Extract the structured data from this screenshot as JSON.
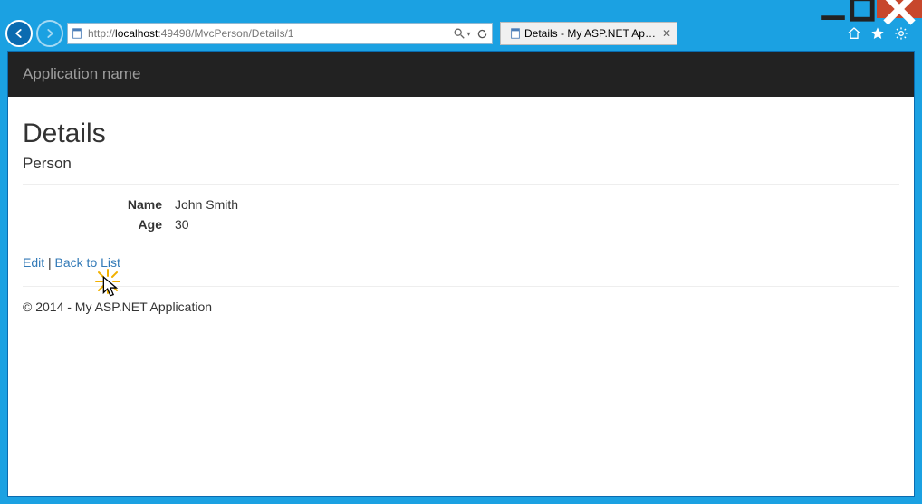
{
  "window": {
    "minimize_tooltip": "Minimize",
    "maximize_tooltip": "Maximize",
    "close_tooltip": "Close"
  },
  "browser": {
    "url": "http://localhost:49498/MvcPerson/Details/1",
    "url_prefix": "http://",
    "url_host": "localhost",
    "url_rest": ":49498/MvcPerson/Details/1",
    "tab_title": "Details - My ASP.NET Appli...",
    "search_placeholder": "",
    "home_tooltip": "Home",
    "fav_tooltip": "Favorites",
    "tools_tooltip": "Tools"
  },
  "nav": {
    "brand": "Application name"
  },
  "page": {
    "heading": "Details",
    "subheading": "Person",
    "fields": {
      "name_label": "Name",
      "name_value": "John Smith",
      "age_label": "Age",
      "age_value": "30"
    },
    "actions": {
      "edit": "Edit",
      "separator": " | ",
      "back": "Back to List"
    },
    "footer": "© 2014 - My ASP.NET Application"
  }
}
